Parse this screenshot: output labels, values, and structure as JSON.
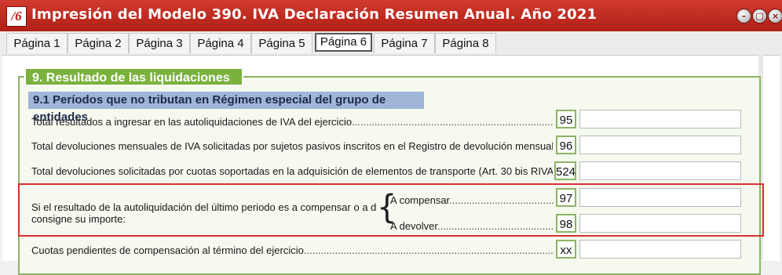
{
  "window": {
    "title": "Impresión del Modelo 390. IVA Declaración Resumen Anual. Año 2021",
    "icon_glyph": "/6"
  },
  "tabs": [
    "Página 1",
    "Página 2",
    "Página 3",
    "Página 4",
    "Página 5",
    "Página 6",
    "Página 7",
    "Página 8"
  ],
  "active_tab": "Página 6",
  "section": {
    "title": "9. Resultado de las liquidaciones",
    "subsection_title": "9.1 Períodos que no tributan en Régimen especial del grupo de entidades"
  },
  "rows": [
    {
      "label": "Total resultados a ingresar en las autoliquidaciones de IVA del ejercicio",
      "dots": "..............................................................................................",
      "code": "95",
      "value": ""
    },
    {
      "label": "Total devoluciones mensuales de IVA solicitadas por sujetos pasivos inscritos en el Registro de devolución mensual",
      "dots": "..............",
      "code": "96",
      "value": ""
    },
    {
      "label": "Total devoluciones solicitadas por cuotas soportadas en la adquisición de elementos de transporte (Art. 30 bis RIVA)",
      "dots": "..........",
      "code": "524",
      "value": ""
    }
  ],
  "final_result": {
    "label_line1": "Si el resultado de la autoliquidación del último periodo es a compensar o a devolver",
    "label_line2": "consigne su importe:",
    "options": [
      {
        "label": "A compensar",
        "dots": "...........................................................",
        "code": "97",
        "value": ""
      },
      {
        "label": "A devolver",
        "dots": "..............................................................",
        "code": "98",
        "value": ""
      }
    ]
  },
  "pending": {
    "label": "Cuotas pendientes de compensación al término del ejercicio",
    "dots": ".........................................................................................................................",
    "code": "xx",
    "value": ""
  }
}
